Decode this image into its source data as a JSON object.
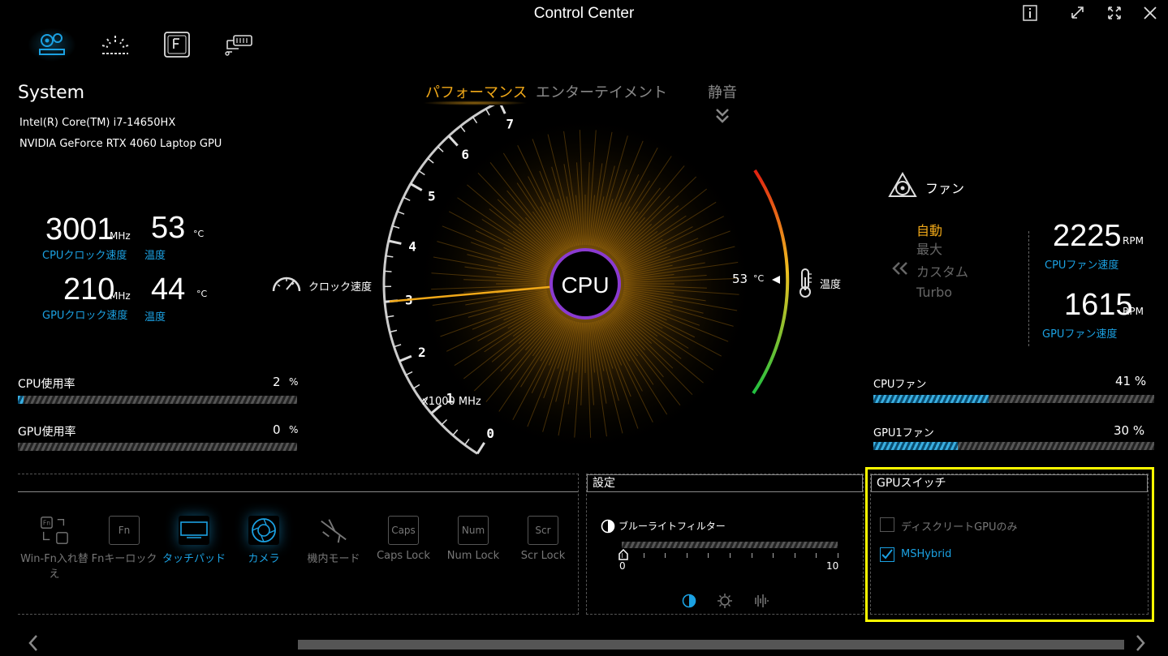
{
  "window": {
    "title": "Control Center"
  },
  "window_buttons": [
    "info-icon",
    "restore-icon",
    "expand-icon",
    "close-icon"
  ],
  "nav_icons": [
    "system-settings-icon",
    "lighting-icon",
    "function-key-icon",
    "fan-usb-icon"
  ],
  "system": {
    "heading": "System",
    "cpu_name": "Intel(R) Core(TM) i7-14650HX",
    "gpu_name": "NVIDIA GeForce RTX 4060 Laptop GPU",
    "cpu_clock": "3001",
    "cpu_clock_unit": "MHz",
    "cpu_clock_label": "CPUクロック速度",
    "cpu_temp": "53",
    "cpu_temp_unit": "°C",
    "cpu_temp_label": "温度",
    "gpu_clock": "210",
    "gpu_clock_unit": "MHz",
    "gpu_clock_label": "GPUクロック速度",
    "gpu_temp": "44",
    "gpu_temp_unit": "°C",
    "gpu_temp_label": "温度",
    "cpu_usage_label": "CPU使用率",
    "cpu_usage": "2",
    "cpu_usage_unit": "%",
    "cpu_usage_value": 2,
    "gpu_usage_label": "GPU使用率",
    "gpu_usage": "0",
    "gpu_usage_unit": "%",
    "gpu_usage_value": 0
  },
  "modes": {
    "performance": "パフォーマンス",
    "entertainment": "エンターテイメント",
    "silent": "静音"
  },
  "gauge": {
    "center_label": "CPU",
    "clock_label": "クロック速度",
    "temp_label": "温度",
    "temp_value": "53",
    "temp_unit": "°C",
    "unit_label": "x1000 MHz",
    "ticks": [
      "0",
      "1",
      "2",
      "3",
      "4",
      "5",
      "6",
      "7"
    ],
    "clock_value_ghz": 3.0
  },
  "fan": {
    "heading": "ファン",
    "modes": [
      "自動",
      "最大",
      "カスタム",
      "Turbo"
    ],
    "active_mode": "自動",
    "cpu_rpm": "2225",
    "cpu_rpm_unit": "RPM",
    "cpu_rpm_label": "CPUファン速度",
    "gpu_rpm": "1615",
    "gpu_rpm_unit": "RPM",
    "gpu_rpm_label": "GPUファン速度",
    "cpu_fan_label": "CPUファン",
    "cpu_fan_pct": "41 %",
    "cpu_fan_value": 41,
    "gpu_fan_label": "GPU1ファン",
    "gpu_fan_pct": "30 %",
    "gpu_fan_value": 30
  },
  "keys": [
    {
      "label": "Win-Fn入れ替え",
      "glyph": "Fn",
      "on": false
    },
    {
      "label": "Fnキーロック",
      "glyph": "Fn",
      "on": false
    },
    {
      "label": "タッチパッド",
      "glyph": "",
      "on": true
    },
    {
      "label": "カメラ",
      "glyph": "",
      "on": true
    },
    {
      "label": "機内モード",
      "glyph": "",
      "on": false
    },
    {
      "label": "Caps Lock",
      "glyph": "Caps",
      "on": false
    },
    {
      "label": "Num Lock",
      "glyph": "Num",
      "on": false
    },
    {
      "label": "Scr Lock",
      "glyph": "Scr",
      "on": false
    }
  ],
  "settings": {
    "heading": "設定",
    "bluelight_label": "ブルーライトフィルター",
    "slider_min": "0",
    "slider_max": "10",
    "slider_value": 0
  },
  "gpu_switch": {
    "heading": "GPUスイッチ",
    "option1": "ディスクリートGPUのみ",
    "option1_checked": false,
    "option2": "MSHybrid",
    "option2_checked": true
  },
  "colors": {
    "accent": "#f0a818",
    "blue": "#1ba1e2",
    "highlight": "#ffff00"
  }
}
